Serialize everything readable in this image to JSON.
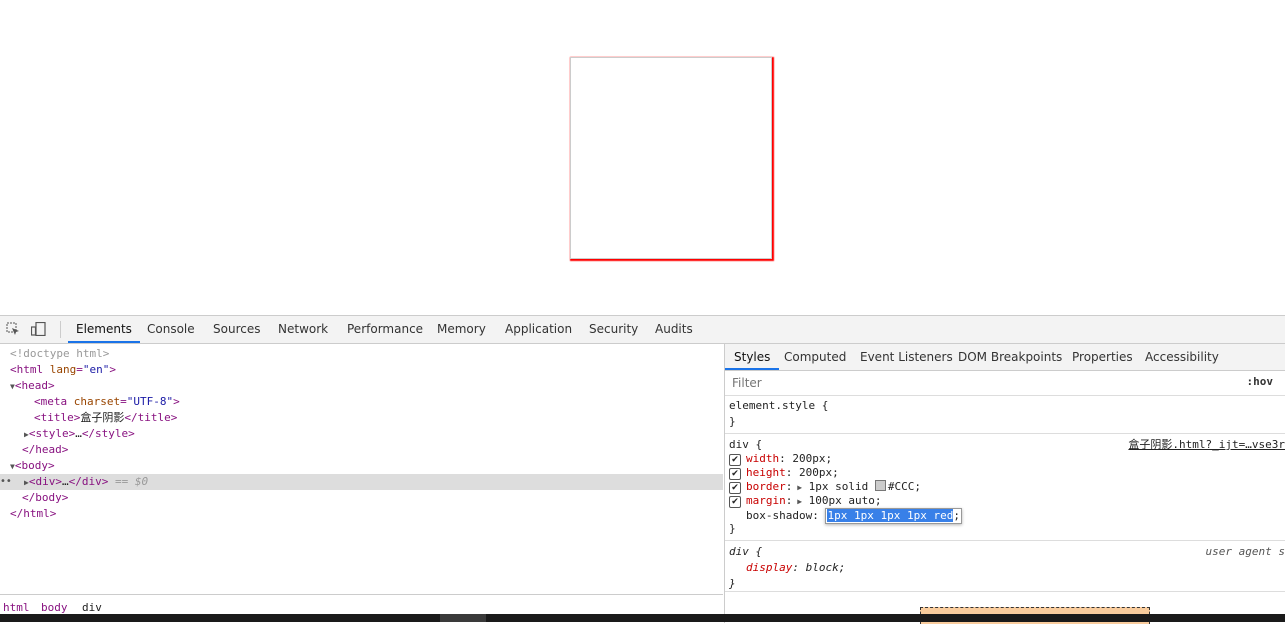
{
  "toolbar": {
    "inspect_icon": "select-element-icon",
    "device_icon": "device-toggle-icon",
    "tabs": [
      "Elements",
      "Console",
      "Sources",
      "Network",
      "Performance",
      "Memory",
      "Application",
      "Security",
      "Audits"
    ],
    "active_tab": "Elements"
  },
  "dom": {
    "doctype": "<!doctype html>",
    "html_open": "<html",
    "html_attr": "lang",
    "html_attr_val": "\"en\"",
    "html_close_bracket": ">",
    "head_open": "<head>",
    "meta_open": "<meta",
    "meta_attr": "charset",
    "meta_attr_val": "\"UTF-8\"",
    "meta_close": ">",
    "title_open": "<title>",
    "title_text": "盒子阴影",
    "title_close": "</title>",
    "style_open": "<style>",
    "style_ellipsis": "…",
    "style_close": "</style>",
    "head_close": "</head>",
    "body_open": "<body>",
    "div_open": "<div>",
    "div_ellipsis": "…",
    "div_close": "</div>",
    "div_eq": "== $0",
    "body_close": "</body>",
    "html_close": "</html>"
  },
  "breadcrumbs": [
    "html",
    "body",
    "div"
  ],
  "styles": {
    "tabs": [
      "Styles",
      "Computed",
      "Event Listeners",
      "DOM Breakpoints",
      "Properties",
      "Accessibility"
    ],
    "active_tab": "Styles",
    "filter_placeholder": "Filter",
    "hov_label": ":hov",
    "element_style_selector": "element.style {",
    "close_brace": "}",
    "div_rule": {
      "selector": "div {",
      "source": "盒子阴影.html?_ijt=…vse3r",
      "props": [
        {
          "name": "width",
          "value": "200px;"
        },
        {
          "name": "height",
          "value": "200px;"
        },
        {
          "name": "border",
          "value": "1px solid",
          "color_text": "#CCC;"
        },
        {
          "name": "margin",
          "value": "100px auto;"
        }
      ],
      "editing_prop": "box-shadow",
      "editing_value_a": "1px",
      "editing_value_b": " 1px 1px 1px red",
      "editing_tail": ";"
    },
    "ua_rule": {
      "selector": "div {",
      "source": "user agent s",
      "prop": "display",
      "value": "block;"
    }
  },
  "colors": {
    "accent": "#1a73e8",
    "selection": "#3880e8",
    "shadow": "red"
  }
}
